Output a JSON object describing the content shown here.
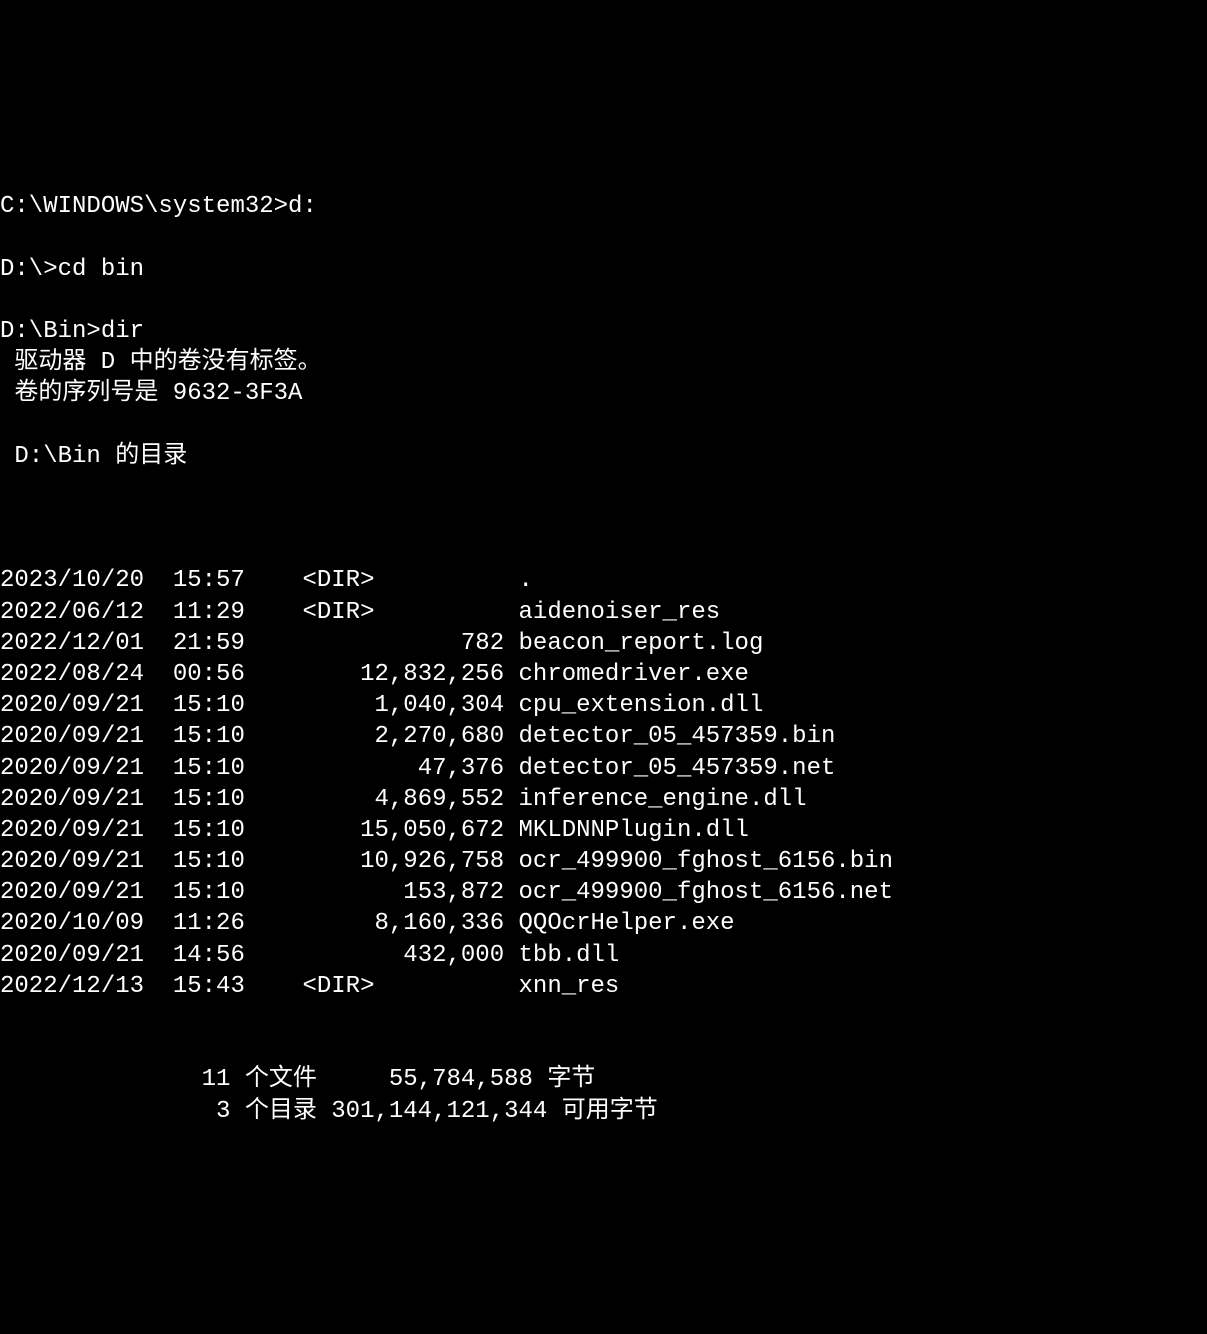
{
  "lines": [
    {
      "prompt": "C:\\WINDOWS\\system32>",
      "command": "d:"
    },
    {
      "blank": true
    },
    {
      "prompt": "D:\\>",
      "command": "cd bin"
    },
    {
      "blank": true
    },
    {
      "prompt": "D:\\Bin>",
      "command": "dir"
    },
    {
      "text": " 驱动器 D 中的卷没有标签。"
    },
    {
      "text": " 卷的序列号是 9632-3F3A"
    },
    {
      "blank": true
    },
    {
      "text": " D:\\Bin 的目录"
    },
    {
      "blank": true
    }
  ],
  "entries": [
    {
      "date": "2023/10/20",
      "time": "15:57",
      "type": "<DIR>",
      "size": "",
      "name": "."
    },
    {
      "date": "2022/06/12",
      "time": "11:29",
      "type": "<DIR>",
      "size": "",
      "name": "aidenoiser_res"
    },
    {
      "date": "2022/12/01",
      "time": "21:59",
      "type": "",
      "size": "782",
      "name": "beacon_report.log"
    },
    {
      "date": "2022/08/24",
      "time": "00:56",
      "type": "",
      "size": "12,832,256",
      "name": "chromedriver.exe"
    },
    {
      "date": "2020/09/21",
      "time": "15:10",
      "type": "",
      "size": "1,040,304",
      "name": "cpu_extension.dll"
    },
    {
      "date": "2020/09/21",
      "time": "15:10",
      "type": "",
      "size": "2,270,680",
      "name": "detector_05_457359.bin"
    },
    {
      "date": "2020/09/21",
      "time": "15:10",
      "type": "",
      "size": "47,376",
      "name": "detector_05_457359.net"
    },
    {
      "date": "2020/09/21",
      "time": "15:10",
      "type": "",
      "size": "4,869,552",
      "name": "inference_engine.dll"
    },
    {
      "date": "2020/09/21",
      "time": "15:10",
      "type": "",
      "size": "15,050,672",
      "name": "MKLDNNPlugin.dll"
    },
    {
      "date": "2020/09/21",
      "time": "15:10",
      "type": "",
      "size": "10,926,758",
      "name": "ocr_499900_fghost_6156.bin"
    },
    {
      "date": "2020/09/21",
      "time": "15:10",
      "type": "",
      "size": "153,872",
      "name": "ocr_499900_fghost_6156.net"
    },
    {
      "date": "2020/10/09",
      "time": "11:26",
      "type": "",
      "size": "8,160,336",
      "name": "QQOcrHelper.exe"
    },
    {
      "date": "2020/09/21",
      "time": "14:56",
      "type": "",
      "size": "432,000",
      "name": "tbb.dll"
    },
    {
      "date": "2022/12/13",
      "time": "15:43",
      "type": "<DIR>",
      "size": "",
      "name": "xnn_res"
    }
  ],
  "summary": {
    "file_count": "11",
    "file_label": "个文件",
    "file_bytes": "55,784,588",
    "file_bytes_label": "字节",
    "dir_count": "3",
    "dir_label": "个目录",
    "free_bytes": "301,144,121,344",
    "free_label": "可用字节"
  }
}
